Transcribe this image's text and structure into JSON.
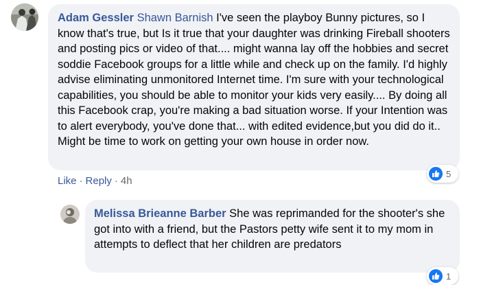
{
  "colors": {
    "link": "#385898",
    "bubble": "#f0f2f5",
    "muted": "#65676b",
    "like_blue": "#1877f2"
  },
  "comment1": {
    "author": "Adam Gessler",
    "mention": "Shawn Barnish",
    "text": " I've seen the playboy Bunny pictures, so I know that's true, but Is it true that your daughter was drinking Fireball shooters and posting pics or video of that.... might wanna lay off the hobbies and secret soddie Facebook groups for a little while and check up on the family. I'd highly advise eliminating unmonitored Internet time. I'm sure with your technological capabilities, you should be able to monitor your kids very easily.... By doing all this Facebook crap, you're making a bad situation worse. If your Intention was to alert everybody, you've done that... with edited evidence,but you did do it.. Might be time to work on getting your own house in order now.",
    "like_label": "Like",
    "reply_label": "Reply",
    "time": "4h",
    "reaction_icon": "like-icon",
    "reaction_count": "5"
  },
  "comment2": {
    "author": "Melissa Brieanne Barber",
    "text": " She was reprimanded for the shooter's she got into with a friend, but the Pastors petty wife sent it to my mom in attempts to deflect that her children are predators",
    "reaction_icon": "like-icon",
    "reaction_count": "1"
  }
}
